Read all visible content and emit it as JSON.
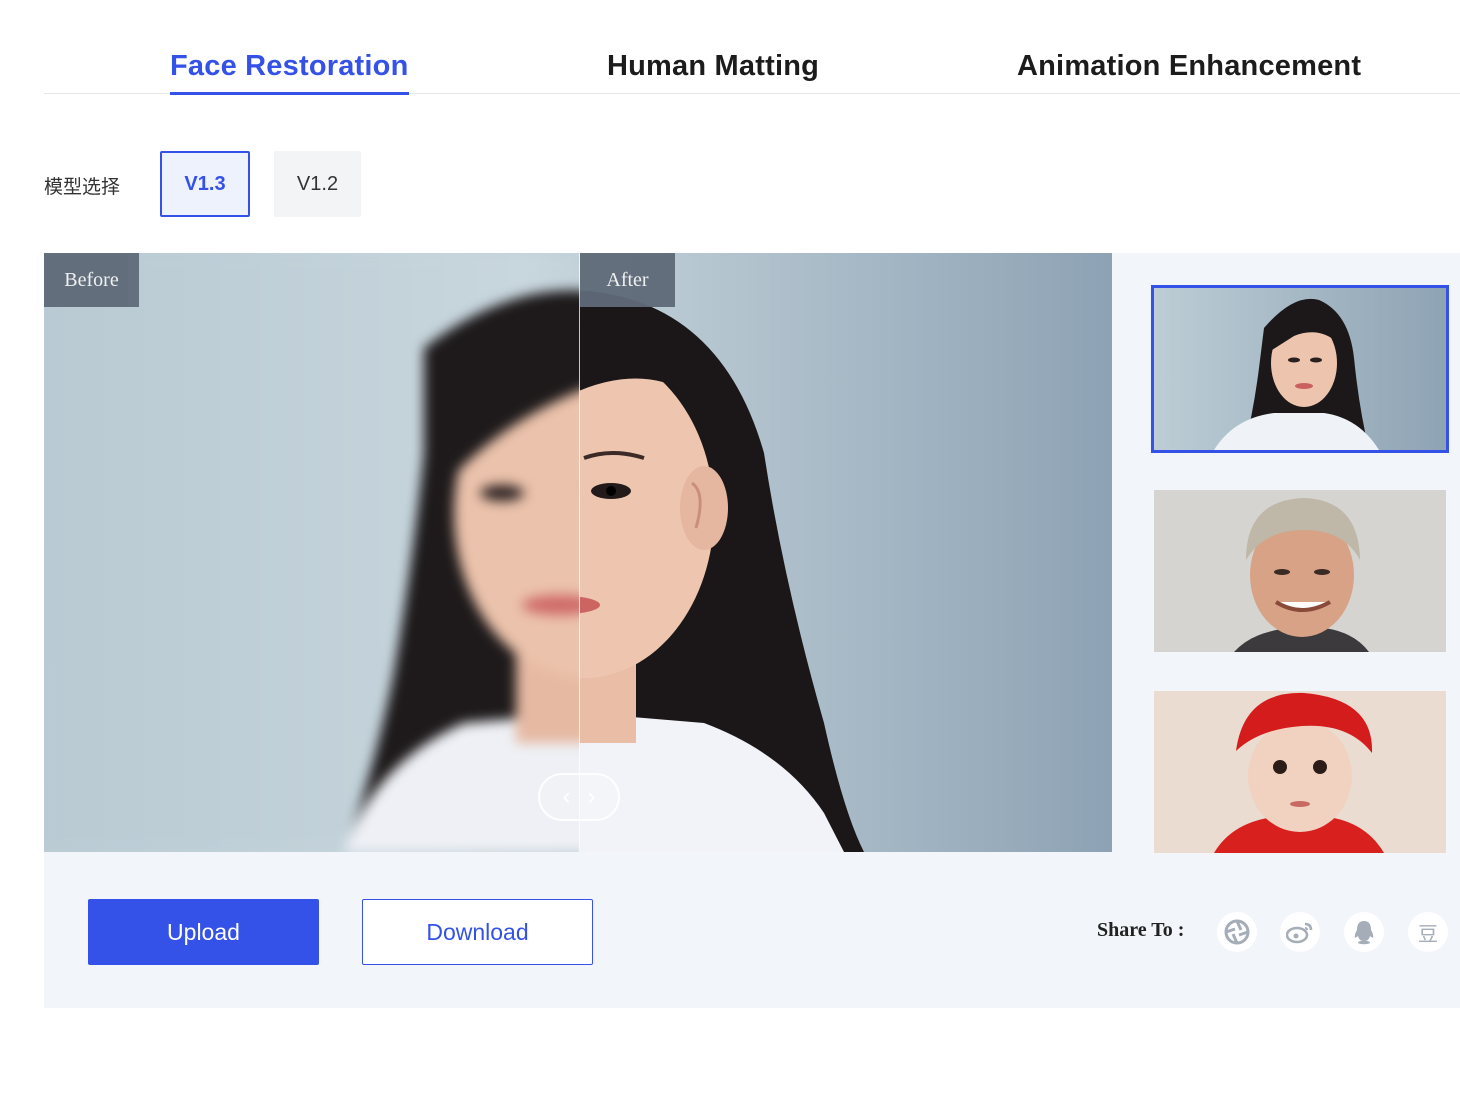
{
  "tabs": [
    {
      "label": "Face Restoration",
      "active": true
    },
    {
      "label": "Human Matting",
      "active": false
    },
    {
      "label": "Animation Enhancement",
      "active": false
    }
  ],
  "model_select": {
    "label": "模型选择",
    "options": [
      "V1.3",
      "V1.2"
    ],
    "selected": "V1.3"
  },
  "compare": {
    "before_label": "Before",
    "after_label": "After",
    "handle_left_icon": "chevron-left-icon",
    "handle_right_icon": "chevron-right-icon"
  },
  "thumbnails": [
    {
      "name": "young-woman-portrait",
      "selected": true
    },
    {
      "name": "older-man-portrait",
      "selected": false
    },
    {
      "name": "child-red-beret-portrait",
      "selected": false
    }
  ],
  "actions": {
    "upload_label": "Upload",
    "download_label": "Download"
  },
  "share": {
    "label": "Share To :",
    "icons": [
      "shutter-icon",
      "weibo-icon",
      "qq-icon",
      "douban-icon"
    ],
    "douban_glyph": "豆"
  },
  "colors": {
    "accent": "#3451e8",
    "panel_bg": "#f2f5f9",
    "tag_bg": "#5f6a78",
    "share_icon": "#a5adb8"
  }
}
